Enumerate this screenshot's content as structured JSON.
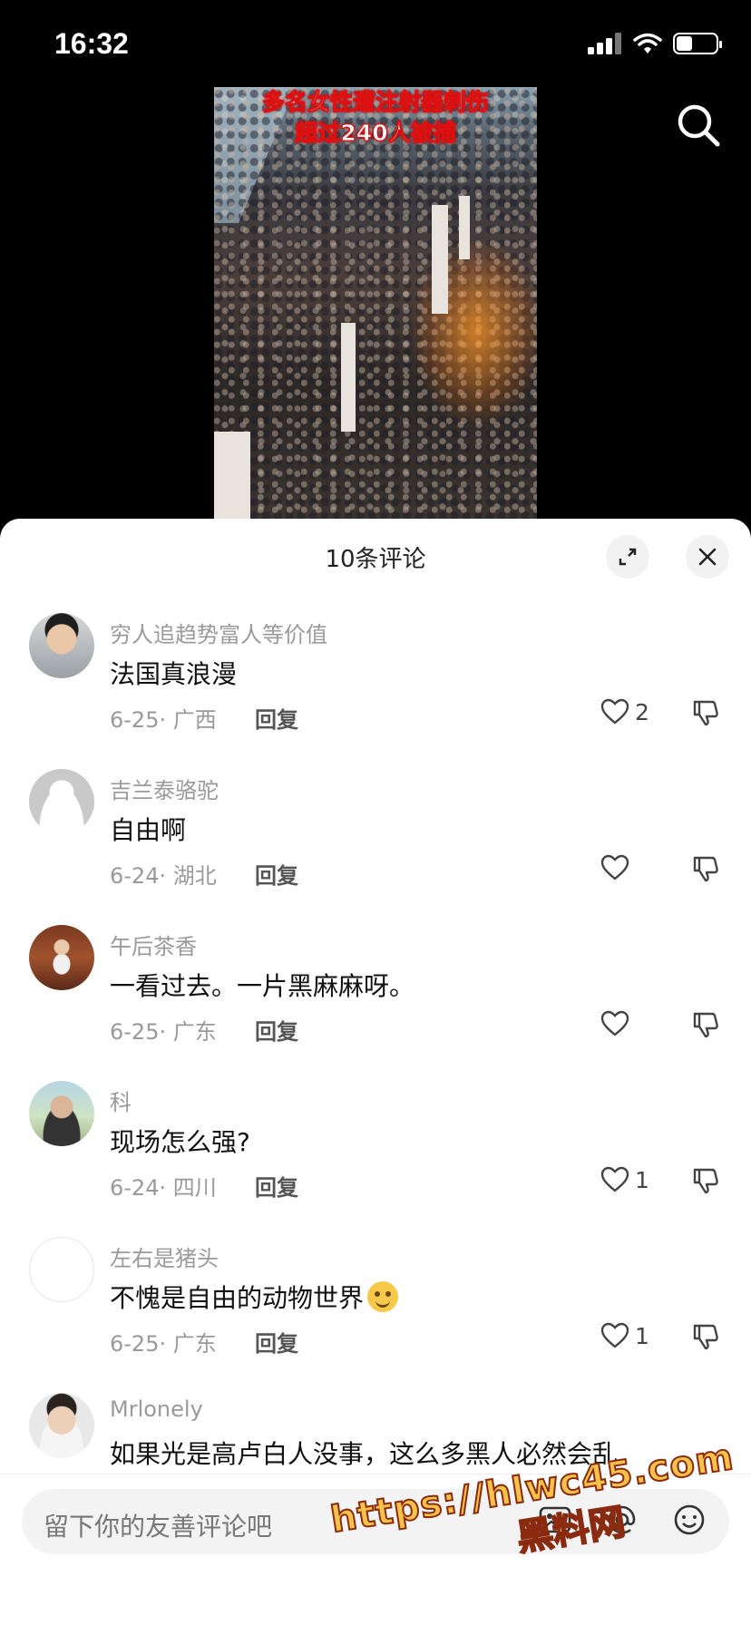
{
  "status_bar": {
    "time": "16:32"
  },
  "video": {
    "caption_line1": "多名女性遭注射器刺伤",
    "caption_line2": "超过240人被捕"
  },
  "comments_panel": {
    "title": "10条评论",
    "comments": [
      {
        "username": "穷人追趋势富人等价值",
        "text": "法国真浪漫",
        "meta": "6-25· 广西",
        "reply": "回复",
        "likes": "2",
        "avatar": "photo-man"
      },
      {
        "username": "吉兰泰骆驼",
        "text": "自由啊",
        "meta": "6-24· 湖北",
        "reply": "回复",
        "likes": "",
        "avatar": "default-avatar"
      },
      {
        "username": "午后茶香",
        "text": "一看过去。一片黑麻麻呀。",
        "meta": "6-25· 广东",
        "reply": "回复",
        "likes": "",
        "avatar": "photo-room"
      },
      {
        "username": "科",
        "text": "现场怎么强?",
        "meta": "6-24· 四川",
        "reply": "回复",
        "likes": "1",
        "avatar": "photo-outdoor"
      },
      {
        "username": "左右是猪头",
        "text": "不愧是自由的动物世界",
        "meta": "6-25· 广东",
        "reply": "回复",
        "likes": "1",
        "avatar": "blank-avatar",
        "emoji": "smile-emoji"
      },
      {
        "username": "Mrlonely",
        "text": "如果光是高卢白人没事，这么多黑人必然会乱",
        "meta": "",
        "reply": "",
        "likes": "",
        "avatar": "photo-man2"
      }
    ]
  },
  "input": {
    "placeholder": "留下你的友善评论吧"
  },
  "watermark": {
    "url": "https://hlwc45.com",
    "name": "黑料网"
  },
  "colors": {
    "accent_red": "#d11111",
    "watermark_yellow": "#f6c24a"
  }
}
